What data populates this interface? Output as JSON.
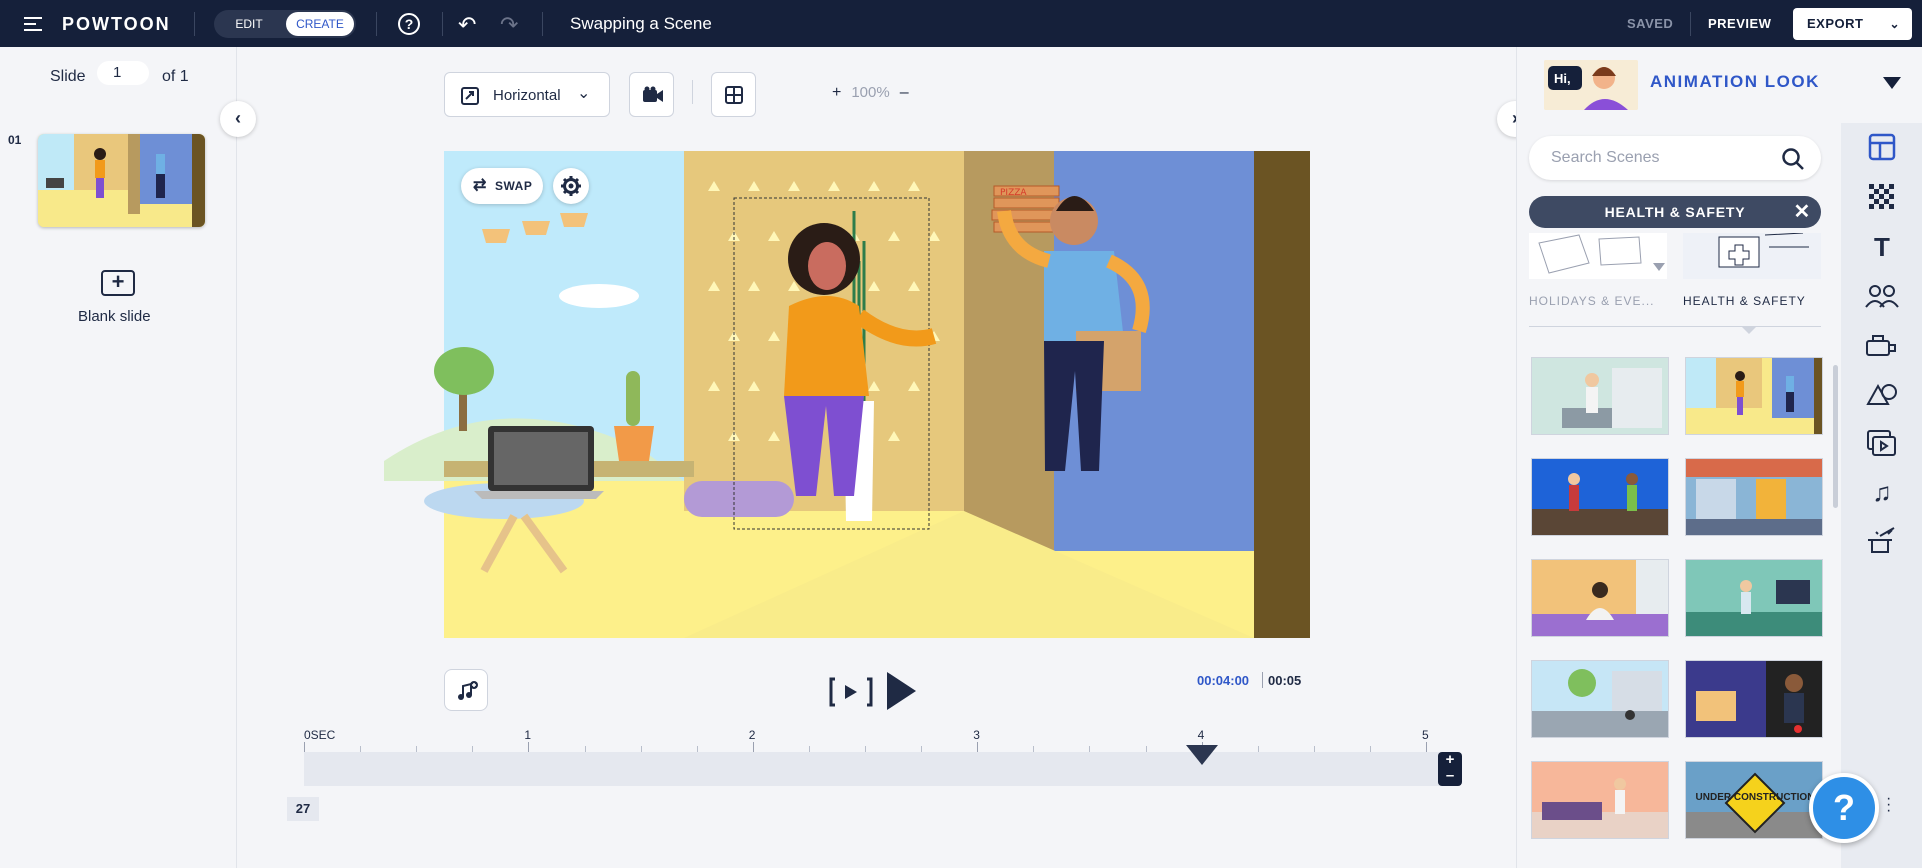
{
  "app": {
    "logo": "POWTOON",
    "doc_title": "Swapping a Scene"
  },
  "topbar": {
    "mode_edit": "EDIT",
    "mode_create": "CREATE",
    "status": "SAVED",
    "preview_label": "PREVIEW",
    "export_label": "EXPORT"
  },
  "slides": {
    "label": "Slide",
    "current": "1",
    "of_label": "of 1",
    "items": [
      {
        "index": "01"
      }
    ],
    "blank_label": "Blank slide"
  },
  "canvas_toolbar": {
    "orientation": "Horizontal",
    "zoom": "100%"
  },
  "scene": {
    "swap_label": "SWAP",
    "pizza_text": "PIZZA"
  },
  "playback": {
    "current_time": "00:04:00",
    "total_time": "00:05",
    "frame": "27",
    "playhead_sec": 4,
    "ticks": [
      "0SEC",
      "1",
      "2",
      "3",
      "4",
      "5"
    ]
  },
  "right_panel": {
    "look_bubble": "Hi,",
    "look_label": "ANIMATION LOOK",
    "search_placeholder": "Search Scenes",
    "active_filter": "HEALTH & SAFETY",
    "categories": [
      {
        "label": "HOLIDAYS & EVE..."
      },
      {
        "label": "HEALTH & SAFETY"
      }
    ],
    "scene_sign_text": "UNDER CONSTRUCTION",
    "rail_icons": [
      "layout-icon",
      "background-pattern-icon",
      "text-icon",
      "characters-icon",
      "props-icon",
      "shapes-icon",
      "media-icon",
      "music-icon",
      "magic-hat-icon"
    ]
  },
  "colors": {
    "topbar": "#15203a",
    "accent": "#2f57c8",
    "help": "#2e8fe6"
  }
}
